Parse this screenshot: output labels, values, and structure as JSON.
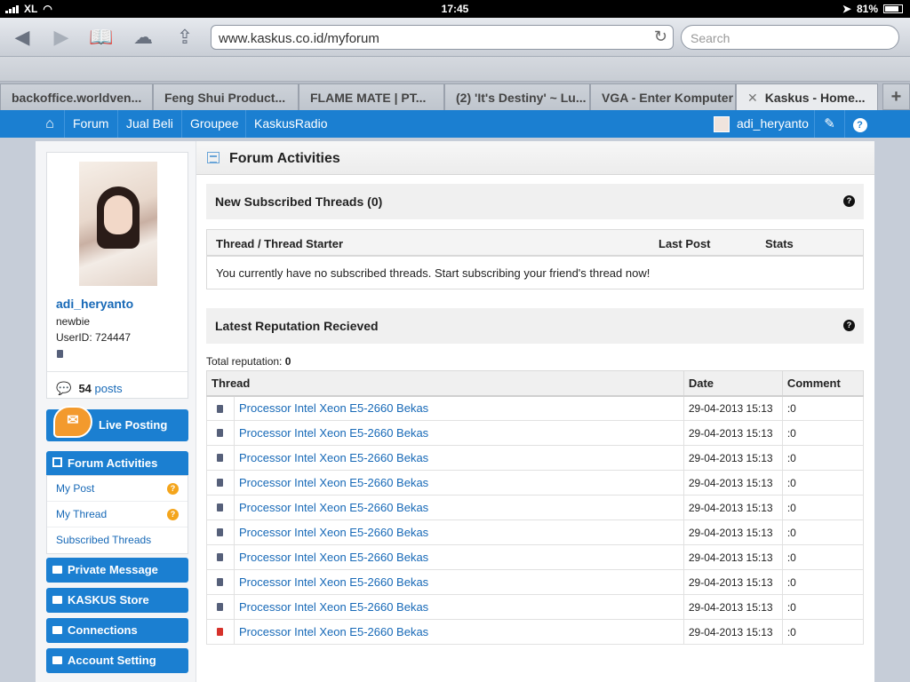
{
  "status": {
    "carrier": "XL",
    "time": "17:45",
    "battery": "81%"
  },
  "browser": {
    "url": "www.kaskus.co.id/myforum",
    "search_placeholder": "Search",
    "tabs": [
      {
        "label": "backoffice.worldven..."
      },
      {
        "label": "Feng Shui Product..."
      },
      {
        "label": "FLAME MATE | PT..."
      },
      {
        "label": "(2) 'It's Destiny' ~ Lu..."
      },
      {
        "label": "VGA - Enter Komputer"
      },
      {
        "label": "Kaskus - Home..."
      }
    ],
    "new_tab": "+"
  },
  "nav": {
    "items": [
      "Forum",
      "Jual Beli",
      "Groupee",
      "KaskusRadio"
    ],
    "username": "adi_heryanto"
  },
  "profile": {
    "username": "adi_heryanto",
    "rank": "newbie",
    "user_id": "UserID: 724447",
    "post_count": "54",
    "post_label": "posts"
  },
  "sidebar": {
    "live_posting": "Live Posting",
    "forum_activities": "Forum Activities",
    "sub_items": [
      "My Post",
      "My Thread",
      "Subscribed Threads"
    ],
    "private_message": "Private Message",
    "store": "KASKUS Store",
    "connections": "Connections",
    "account_setting": "Account Setting"
  },
  "main": {
    "title": "Forum Activities",
    "subscribed": {
      "title": "New Subscribed Threads (0)",
      "col_thread": "Thread / Thread Starter",
      "col_last": "Last Post",
      "col_stats": "Stats",
      "empty": "You currently have no subscribed threads. Start subscribing your friend's thread now!"
    },
    "reputation": {
      "title": "Latest Reputation Recieved",
      "total_label": "Total reputation:",
      "total_value": "0",
      "columns": [
        "Thread",
        "Date",
        "Comment"
      ],
      "rows": [
        {
          "thread": "Processor Intel Xeon E5-2660 Bekas",
          "date": "29-04-2013 15:13",
          "comment": ":0",
          "mark": "gray"
        },
        {
          "thread": "Processor Intel Xeon E5-2660 Bekas",
          "date": "29-04-2013 15:13",
          "comment": ":0",
          "mark": "gray"
        },
        {
          "thread": "Processor Intel Xeon E5-2660 Bekas",
          "date": "29-04-2013 15:13",
          "comment": ":0",
          "mark": "gray"
        },
        {
          "thread": "Processor Intel Xeon E5-2660 Bekas",
          "date": "29-04-2013 15:13",
          "comment": ":0",
          "mark": "gray"
        },
        {
          "thread": "Processor Intel Xeon E5-2660 Bekas",
          "date": "29-04-2013 15:13",
          "comment": ":0",
          "mark": "gray"
        },
        {
          "thread": "Processor Intel Xeon E5-2660 Bekas",
          "date": "29-04-2013 15:13",
          "comment": ":0",
          "mark": "gray"
        },
        {
          "thread": "Processor Intel Xeon E5-2660 Bekas",
          "date": "29-04-2013 15:13",
          "comment": ":0",
          "mark": "gray"
        },
        {
          "thread": "Processor Intel Xeon E5-2660 Bekas",
          "date": "29-04-2013 15:13",
          "comment": ":0",
          "mark": "gray"
        },
        {
          "thread": "Processor Intel Xeon E5-2660 Bekas",
          "date": "29-04-2013 15:13",
          "comment": ":0",
          "mark": "gray"
        },
        {
          "thread": "Processor Intel Xeon E5-2660 Bekas",
          "date": "29-04-2013 15:13",
          "comment": ":0",
          "mark": "red"
        }
      ]
    }
  },
  "colors": {
    "kaskus_blue": "#1b7fd1",
    "link_blue": "#1769b7",
    "notify_orange": "#f4a51c",
    "neg_rep_red": "#d6322b"
  }
}
